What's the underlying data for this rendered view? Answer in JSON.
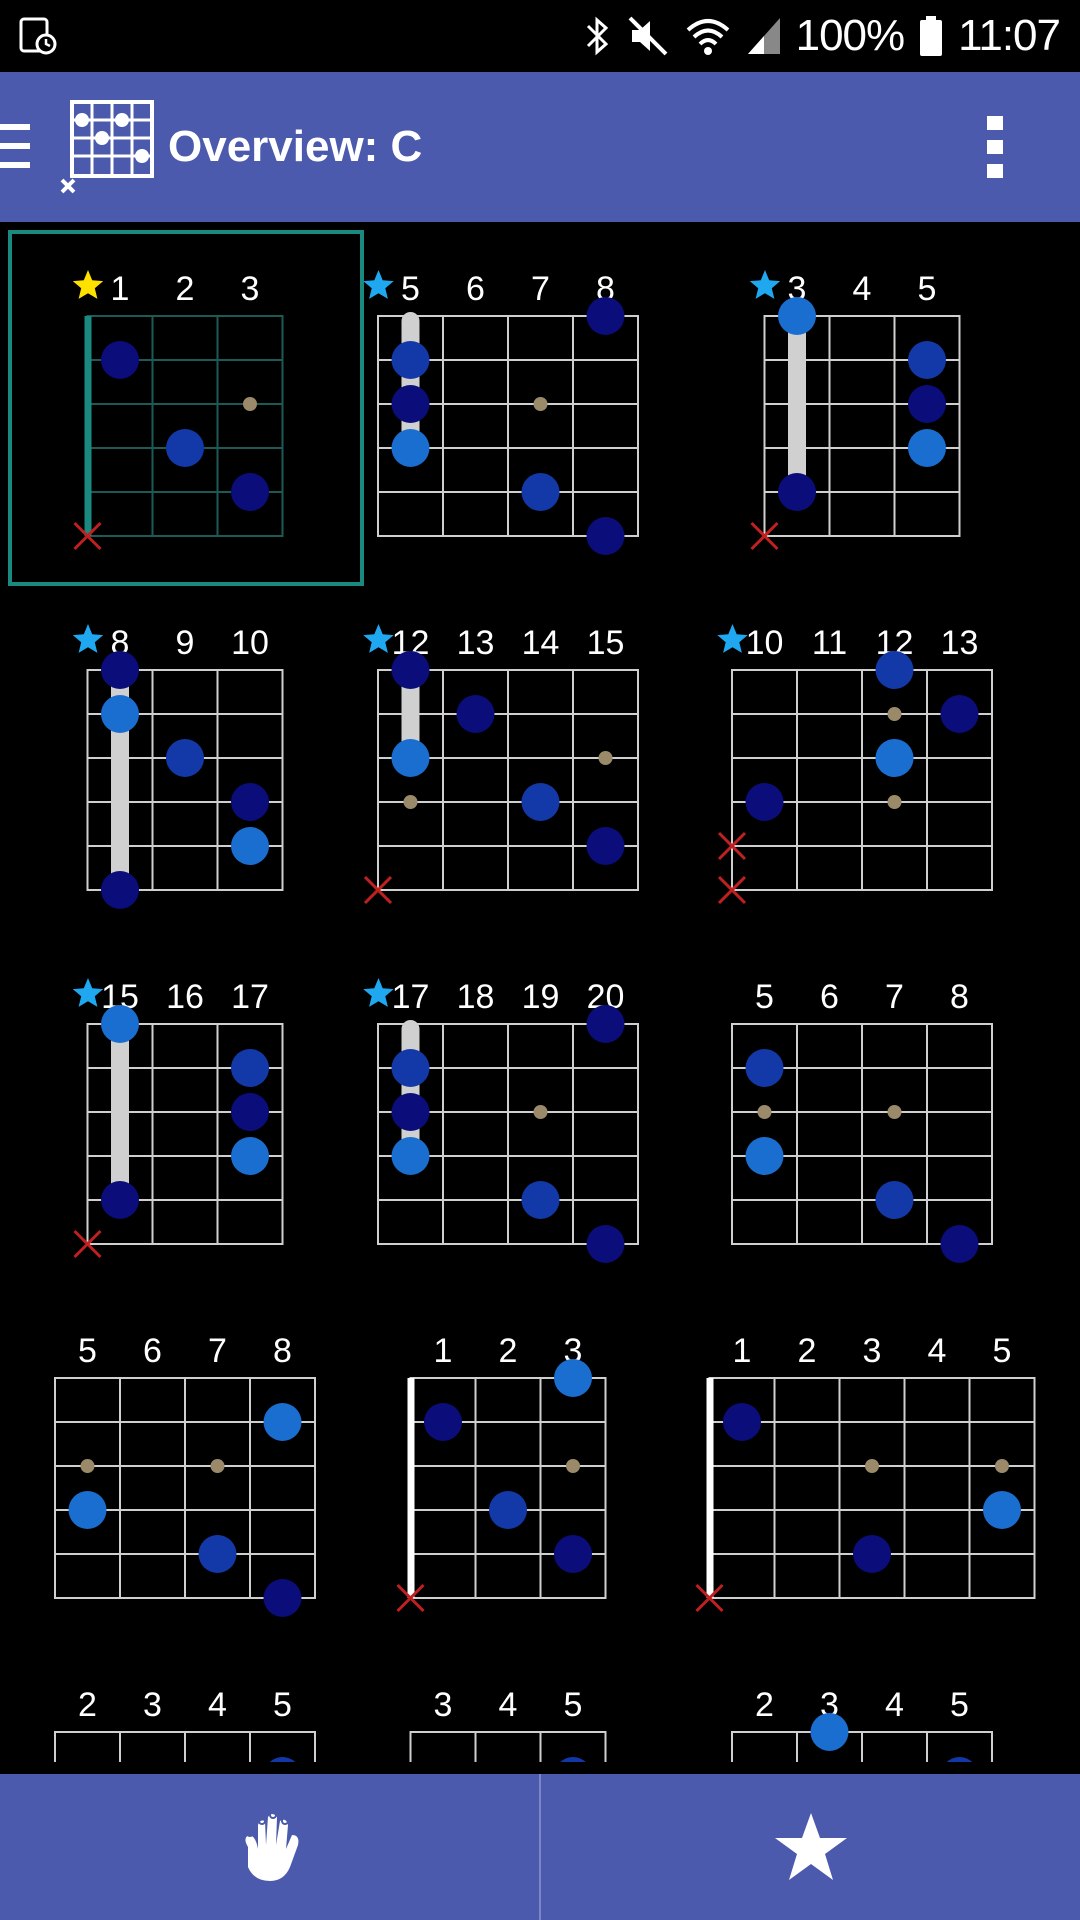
{
  "status_bar": {
    "battery_text": "100%",
    "time": "11:07"
  },
  "app_bar": {
    "title": "Overview: C"
  },
  "colors": {
    "app_bar": "#4b5aad",
    "dot_dark": "#0a0d7a",
    "dot_mid": "#1338a8",
    "dot_light": "#1a6ed0",
    "star_yellow": "#ffe100",
    "star_blue": "#1fa8f0",
    "selected_border": "#1a8a80",
    "mute_x": "#c02020",
    "marker": "#9a8a6a"
  },
  "diagrams": [
    {
      "frets": [
        "1",
        "2",
        "3"
      ],
      "star": "yellow",
      "selected": true,
      "nut": "teal",
      "dots": [
        [
          1,
          1,
          "dark"
        ],
        [
          3,
          2,
          "mid"
        ],
        [
          4,
          3,
          "dark"
        ]
      ],
      "markers": [
        [
          2,
          3
        ]
      ],
      "barre": null,
      "mutes": [
        5
      ]
    },
    {
      "frets": [
        "5",
        "6",
        "7",
        "8"
      ],
      "star": "blue",
      "nut": null,
      "dots": [
        [
          0,
          4,
          "dark"
        ],
        [
          1,
          1,
          "mid"
        ],
        [
          2,
          1,
          "dark"
        ],
        [
          3,
          1,
          "light"
        ],
        [
          4,
          3,
          "mid"
        ],
        [
          5,
          4,
          "dark"
        ]
      ],
      "markers": [
        [
          2,
          3
        ]
      ],
      "barre": [
        0,
        3
      ],
      "mutes": []
    },
    {
      "frets": [
        "3",
        "4",
        "5"
      ],
      "star": "blue",
      "nut": null,
      "dots": [
        [
          0,
          1,
          "light"
        ],
        [
          1,
          3,
          "mid"
        ],
        [
          2,
          3,
          "dark"
        ],
        [
          3,
          3,
          "light"
        ],
        [
          4,
          1,
          "dark"
        ]
      ],
      "markers": [
        [
          2,
          3
        ]
      ],
      "barre": [
        0,
        4
      ],
      "mutes": [
        5
      ]
    },
    {
      "frets": [
        "8",
        "9",
        "10"
      ],
      "star": "blue",
      "nut": null,
      "dots": [
        [
          0,
          1,
          "dark"
        ],
        [
          1,
          1,
          "light"
        ],
        [
          2,
          2,
          "mid"
        ],
        [
          3,
          3,
          "dark"
        ],
        [
          4,
          3,
          "light"
        ],
        [
          5,
          1,
          "dark"
        ]
      ],
      "markers": [
        [
          2,
          2
        ]
      ],
      "barre": [
        0,
        5
      ],
      "mutes": []
    },
    {
      "frets": [
        "12",
        "13",
        "14",
        "15"
      ],
      "star": "blue",
      "nut": null,
      "dots": [
        [
          0,
          1,
          "dark"
        ],
        [
          1,
          2,
          "dark"
        ],
        [
          2,
          1,
          "light"
        ],
        [
          3,
          3,
          "mid"
        ],
        [
          4,
          4,
          "dark"
        ]
      ],
      "markers": [
        [
          2,
          4
        ],
        [
          3,
          1
        ]
      ],
      "barre": [
        0,
        2
      ],
      "mutes": [
        5
      ]
    },
    {
      "frets": [
        "10",
        "11",
        "12",
        "13"
      ],
      "star": "blue",
      "nut": null,
      "dots": [
        [
          0,
          3,
          "mid"
        ],
        [
          1,
          4,
          "dark"
        ],
        [
          2,
          3,
          "light"
        ],
        [
          3,
          1,
          "dark"
        ]
      ],
      "markers": [
        [
          1,
          3
        ],
        [
          3,
          3
        ]
      ],
      "barre": null,
      "mutes": [
        4,
        5
      ]
    },
    {
      "frets": [
        "15",
        "16",
        "17"
      ],
      "star": "blue",
      "nut": null,
      "dots": [
        [
          0,
          1,
          "light"
        ],
        [
          1,
          3,
          "mid"
        ],
        [
          2,
          3,
          "dark"
        ],
        [
          3,
          3,
          "light"
        ],
        [
          4,
          1,
          "dark"
        ]
      ],
      "markers": [
        [
          2,
          3
        ]
      ],
      "barre": [
        0,
        4
      ],
      "mutes": [
        5
      ]
    },
    {
      "frets": [
        "17",
        "18",
        "19",
        "20"
      ],
      "star": "blue",
      "nut": null,
      "dots": [
        [
          0,
          4,
          "dark"
        ],
        [
          1,
          1,
          "mid"
        ],
        [
          2,
          1,
          "dark"
        ],
        [
          3,
          1,
          "light"
        ],
        [
          4,
          3,
          "mid"
        ],
        [
          5,
          4,
          "dark"
        ]
      ],
      "markers": [
        [
          2,
          3
        ]
      ],
      "barre": [
        0,
        3
      ],
      "mutes": []
    },
    {
      "frets": [
        "5",
        "6",
        "7",
        "8"
      ],
      "star": null,
      "nut": null,
      "dots": [
        [
          1,
          1,
          "mid"
        ],
        [
          3,
          1,
          "light"
        ],
        [
          4,
          3,
          "mid"
        ],
        [
          5,
          4,
          "dark"
        ]
      ],
      "markers": [
        [
          2,
          1
        ],
        [
          2,
          3
        ]
      ],
      "barre": null,
      "mutes": []
    },
    {
      "frets": [
        "5",
        "6",
        "7",
        "8"
      ],
      "star": null,
      "nut": null,
      "dots": [
        [
          1,
          4,
          "light"
        ],
        [
          3,
          1,
          "light"
        ],
        [
          4,
          3,
          "mid"
        ],
        [
          5,
          4,
          "dark"
        ]
      ],
      "markers": [
        [
          2,
          1
        ],
        [
          2,
          3
        ]
      ],
      "barre": null,
      "mutes": []
    },
    {
      "frets": [
        "1",
        "2",
        "3"
      ],
      "star": null,
      "nut": "white",
      "dots": [
        [
          0,
          3,
          "light"
        ],
        [
          1,
          1,
          "dark"
        ],
        [
          3,
          2,
          "mid"
        ],
        [
          4,
          3,
          "dark"
        ]
      ],
      "markers": [
        [
          2,
          3
        ]
      ],
      "barre": null,
      "mutes": [
        5
      ]
    },
    {
      "frets": [
        "1",
        "2",
        "3",
        "4",
        "5"
      ],
      "star": null,
      "nut": "white",
      "dots": [
        [
          1,
          1,
          "dark"
        ],
        [
          3,
          5,
          "light"
        ],
        [
          4,
          3,
          "dark"
        ]
      ],
      "markers": [
        [
          2,
          3
        ],
        [
          2,
          5
        ]
      ],
      "barre": null,
      "mutes": [
        5
      ]
    },
    {
      "frets": [
        "2",
        "3",
        "4",
        "5"
      ],
      "star": null,
      "nut": null,
      "dots": [
        [
          1,
          4,
          "mid"
        ]
      ],
      "markers": [],
      "barre": null,
      "mutes": []
    },
    {
      "frets": [
        "3",
        "4",
        "5"
      ],
      "star": null,
      "nut": null,
      "dots": [
        [
          1,
          3,
          "mid"
        ]
      ],
      "markers": [],
      "barre": null,
      "mutes": []
    },
    {
      "frets": [
        "2",
        "3",
        "4",
        "5"
      ],
      "star": null,
      "nut": null,
      "dots": [
        [
          0,
          2,
          "light"
        ],
        [
          1,
          4,
          "mid"
        ]
      ],
      "markers": [],
      "barre": null,
      "mutes": []
    }
  ],
  "bottom_bar": {
    "left_icon": "hand-icon",
    "right_icon": "star-icon"
  }
}
